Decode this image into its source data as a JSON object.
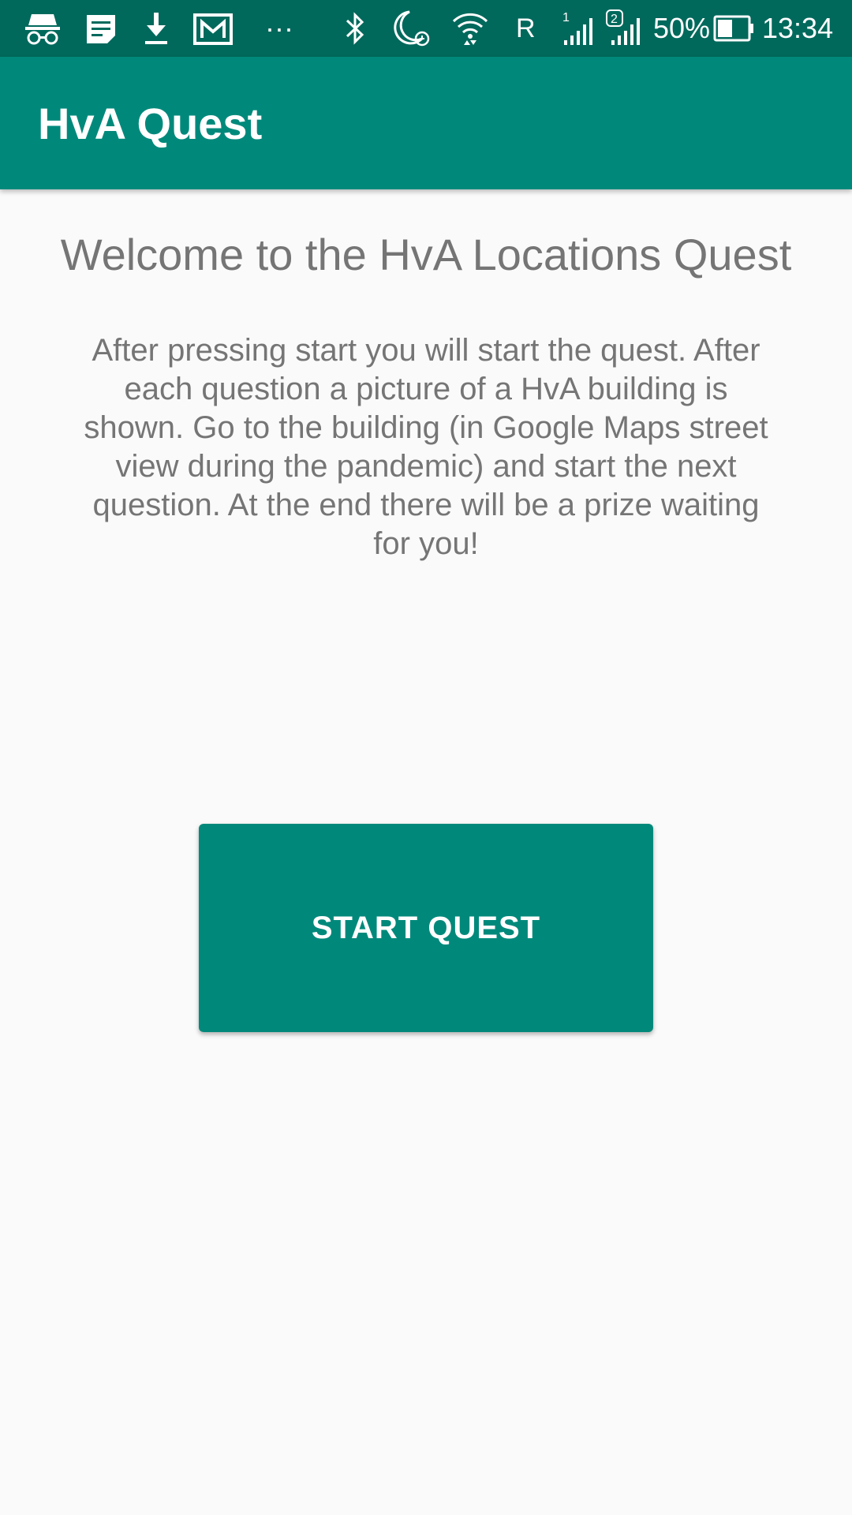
{
  "status_bar": {
    "icons": [
      "incognito-icon",
      "notes-icon",
      "download-icon",
      "gmail-icon",
      "more-notifications-icon",
      "bluetooth-icon",
      "do-not-disturb-alarm-icon",
      "wifi-icon",
      "roaming-icon",
      "signal-sim1-icon",
      "signal-sim2-icon",
      "battery-icon"
    ],
    "roaming": "R",
    "sim1": "1",
    "sim2": "2",
    "battery_percent": "50%",
    "time": "13:34",
    "more": "···"
  },
  "app_bar": {
    "title": "HvA Quest"
  },
  "main": {
    "welcome_title": "Welcome to the HvA Locations Quest",
    "description": "After pressing start you will start the quest. After each question a picture of a HvA building is shown. Go to the building (in Google Maps street view during the pandemic) and start the next question. At the end there will be a prize waiting for you!",
    "start_button_label": "START QUEST"
  },
  "colors": {
    "status_bar": "#00695c",
    "app_bar": "#00897b",
    "button": "#00897b",
    "body_text": "#757575",
    "background": "#fafafa"
  }
}
